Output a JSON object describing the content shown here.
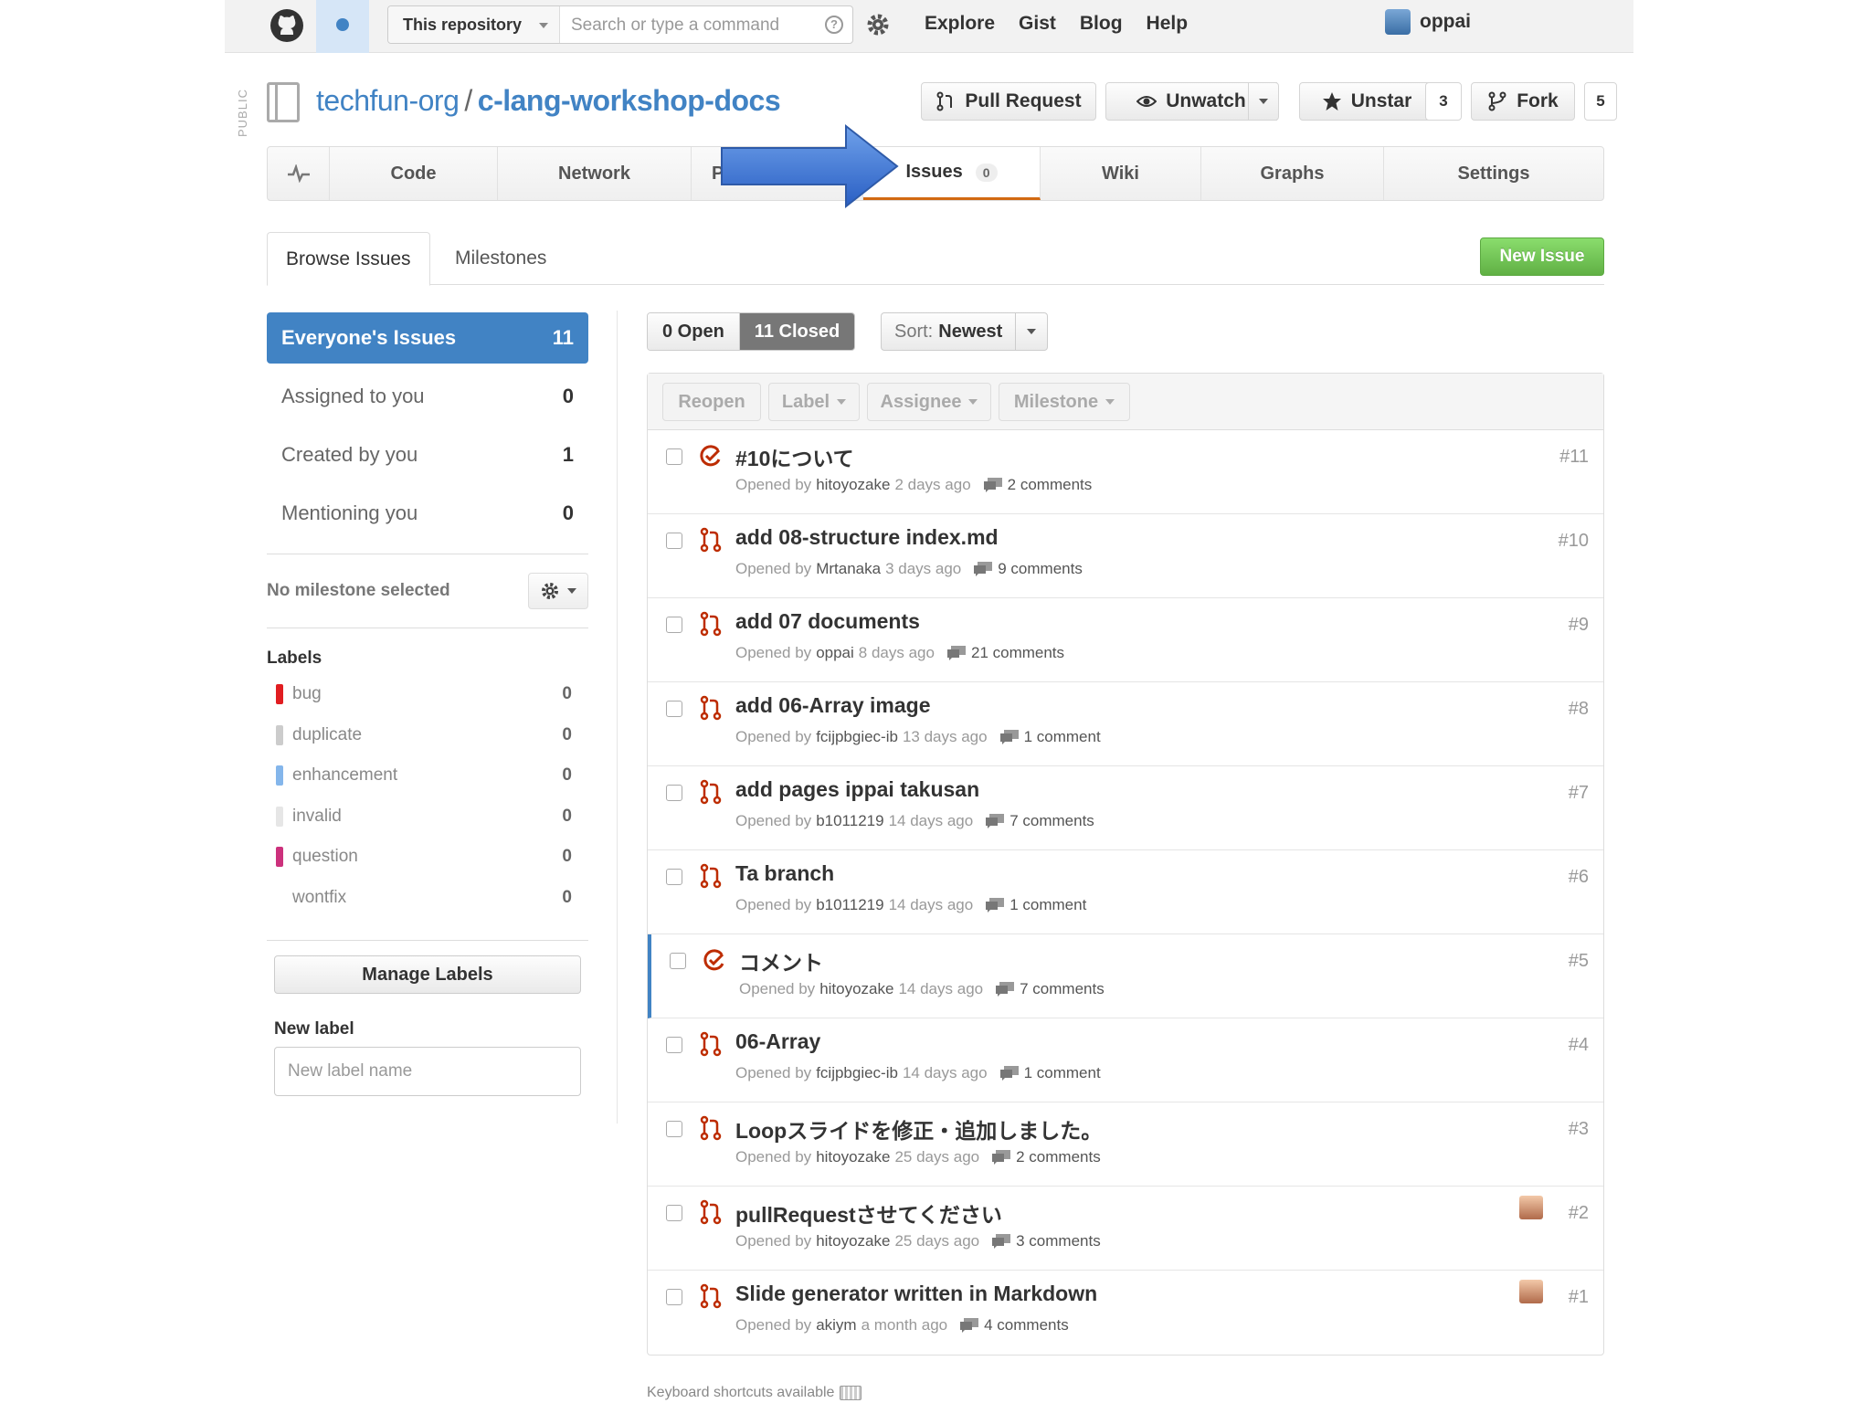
{
  "header": {
    "search_scope": "This repository",
    "search_placeholder": "Search or type a command",
    "nav": [
      "Explore",
      "Gist",
      "Blog",
      "Help"
    ],
    "username": "oppai"
  },
  "repo": {
    "visibility": "PUBLIC",
    "owner": "techfun-org",
    "separator": "/",
    "name": "c-lang-workshop-docs",
    "pull_request_label": "Pull Request",
    "unwatch_label": "Unwatch",
    "unstar_label": "Unstar",
    "star_count": "3",
    "fork_label": "Fork",
    "fork_count": "5"
  },
  "repo_nav": {
    "code": "Code",
    "network": "Network",
    "pulls_partial": "P",
    "issues": "Issues",
    "issues_count": "0",
    "wiki": "Wiki",
    "graphs": "Graphs",
    "settings": "Settings"
  },
  "browse_tabs": {
    "browse": "Browse Issues",
    "milestones": "Milestones"
  },
  "new_issue_label": "New Issue",
  "filters": [
    {
      "label": "Everyone's Issues",
      "count": "11"
    },
    {
      "label": "Assigned to you",
      "count": "0"
    },
    {
      "label": "Created by you",
      "count": "1"
    },
    {
      "label": "Mentioning you",
      "count": "0"
    }
  ],
  "milestone_text": "No milestone selected",
  "labels_heading": "Labels",
  "labels": [
    {
      "name": "bug",
      "count": "0",
      "color": "#e11d21"
    },
    {
      "name": "duplicate",
      "count": "0",
      "color": "#cccccc"
    },
    {
      "name": "enhancement",
      "count": "0",
      "color": "#84b6eb"
    },
    {
      "name": "invalid",
      "count": "0",
      "color": "#e6e6e6"
    },
    {
      "name": "question",
      "count": "0",
      "color": "#cc317c"
    },
    {
      "name": "wontfix",
      "count": "0",
      "color": "#ffffff"
    }
  ],
  "manage_labels": "Manage Labels",
  "new_label_heading": "New label",
  "new_label_placeholder": "New label name",
  "state": {
    "open": "0 Open",
    "closed": "11 Closed"
  },
  "sort": {
    "prefix": "Sort:",
    "value": "Newest"
  },
  "actions": {
    "reopen": "Reopen",
    "label": "Label",
    "assignee": "Assignee",
    "milestone": "Milestone"
  },
  "opened_by_text": "Opened by",
  "issues": [
    {
      "title": "#10について",
      "author": "hitoyozake",
      "time": "2 days ago",
      "comments": "2 comments",
      "number": "#11",
      "type": "issue"
    },
    {
      "title": "add 08-structure index.md",
      "author": "Mrtanaka",
      "time": "3 days ago",
      "comments": "9 comments",
      "number": "#10",
      "type": "pull"
    },
    {
      "title": "add 07 documents",
      "author": "oppai",
      "time": "8 days ago",
      "comments": "21 comments",
      "number": "#9",
      "type": "pull"
    },
    {
      "title": "add 06-Array image",
      "author": "fcijpbgiec-ib",
      "time": "13 days ago",
      "comments": "1 comment",
      "number": "#8",
      "type": "pull"
    },
    {
      "title": "add pages ippai takusan",
      "author": "b1011219",
      "time": "14 days ago",
      "comments": "7 comments",
      "number": "#7",
      "type": "pull"
    },
    {
      "title": "Ta branch",
      "author": "b1011219",
      "time": "14 days ago",
      "comments": "1 comment",
      "number": "#6",
      "type": "pull"
    },
    {
      "title": "コメント",
      "author": "hitoyozake",
      "time": "14 days ago",
      "comments": "7 comments",
      "number": "#5",
      "type": "issue"
    },
    {
      "title": "06-Array",
      "author": "fcijpbgiec-ib",
      "time": "14 days ago",
      "comments": "1 comment",
      "number": "#4",
      "type": "pull"
    },
    {
      "title": "Loopスライドを修正・追加しました。",
      "author": "hitoyozake",
      "time": "25 days ago",
      "comments": "2 comments",
      "number": "#3",
      "type": "pull"
    },
    {
      "title": "pullRequestさせてください",
      "author": "hitoyozake",
      "time": "25 days ago",
      "comments": "3 comments",
      "number": "#2",
      "type": "pull"
    },
    {
      "title": "Slide generator written in Markdown",
      "author": "akiym",
      "time": "a month ago",
      "comments": "4 comments",
      "number": "#1",
      "type": "pull"
    }
  ],
  "footer_note": "Keyboard shortcuts available"
}
